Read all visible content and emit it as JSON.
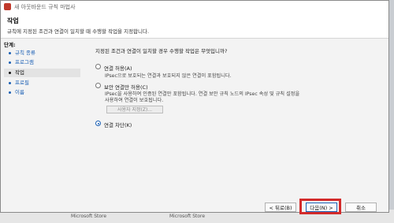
{
  "window": {
    "title": "새 아웃바운드 규칙 마법사"
  },
  "header": {
    "title": "작업",
    "subtitle": "규칙에 지정된 조건과 연결이 일치할 때 수행할 작업을 지정합니다."
  },
  "steps": {
    "label": "단계:",
    "items": [
      {
        "label": "규칙 종류"
      },
      {
        "label": "프로그램"
      },
      {
        "label": "작업"
      },
      {
        "label": "프로필"
      },
      {
        "label": "이름"
      }
    ]
  },
  "content": {
    "question": "지정된 조건과 연결이 일치할 경우 수행할 작업은 무엇입니까?",
    "options": [
      {
        "label": "연결 허용(A)",
        "desc": [
          "IPsec으로 보호되는 연결과 보호되지 않은 연결이 포함됩니다."
        ],
        "selected": false
      },
      {
        "label": "보안 연결만 허용(C)",
        "desc": [
          "IPsec을 사용하여 인증된 연결만 포함됩니다. 연결 보안 규칙 노드의 IPsec 속성 및 규칙 설정을",
          "사용하여 연결이 보호됩니다."
        ],
        "selected": false
      },
      {
        "label": "연결 차단(K)",
        "desc": [],
        "selected": true
      }
    ],
    "custom_button": "사용자 지정(Z)..."
  },
  "buttons": {
    "back": "< 뒤로(B)",
    "next": "다음(N) >",
    "cancel": "취소"
  },
  "background": {
    "items": [
      "Microsoft Store",
      "Microsoft Store"
    ]
  },
  "colors": {
    "accent": "#1a5fb4",
    "highlight": "#d32b2b"
  }
}
